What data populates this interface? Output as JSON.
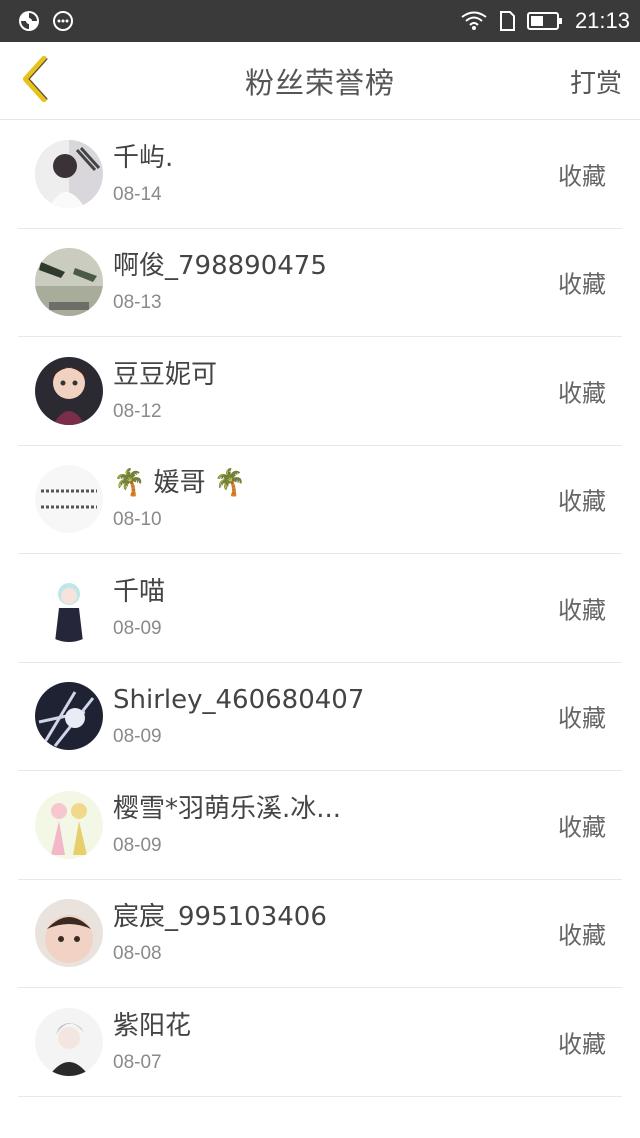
{
  "status_bar": {
    "time": "21:13",
    "icons": [
      "sync-icon",
      "chat-bubble-icon",
      "wifi-icon",
      "sim-icon",
      "battery-icon"
    ]
  },
  "header": {
    "title": "粉丝荣誉榜",
    "right_action": "打赏",
    "back_icon": "chevron-left-icon",
    "accent_color": "#e8c21a"
  },
  "fans": [
    {
      "name": "千屿.",
      "date": "08-14",
      "action": "收藏"
    },
    {
      "name": "啊俊_798890475",
      "date": "08-13",
      "action": "收藏"
    },
    {
      "name": "豆豆妮可",
      "date": "08-12",
      "action": "收藏"
    },
    {
      "name": "🌴 媛哥 🌴",
      "date": "08-10",
      "action": "收藏"
    },
    {
      "name": "千喵",
      "date": "08-09",
      "action": "收藏"
    },
    {
      "name": "Shirley_460680407",
      "date": "08-09",
      "action": "收藏"
    },
    {
      "name": "樱雪*羽萌乐溪.冰...",
      "date": "08-09",
      "action": "收藏"
    },
    {
      "name": "宸宸_995103406",
      "date": "08-08",
      "action": "收藏"
    },
    {
      "name": "紫阳花",
      "date": "08-07",
      "action": "收藏"
    }
  ]
}
